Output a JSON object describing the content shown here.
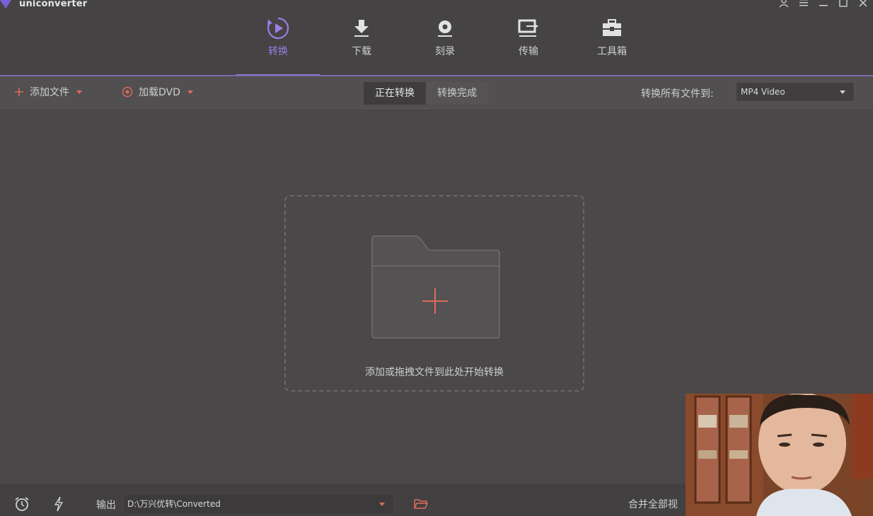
{
  "app": {
    "title": "uniconverter"
  },
  "nav": {
    "items": [
      {
        "label": "转换",
        "icon": "convert-icon",
        "active": true
      },
      {
        "label": "下载",
        "icon": "download-icon",
        "active": false
      },
      {
        "label": "刻录",
        "icon": "burn-disc-icon",
        "active": false
      },
      {
        "label": "传输",
        "icon": "transfer-icon",
        "active": false
      },
      {
        "label": "工具箱",
        "icon": "toolbox-icon",
        "active": false
      }
    ]
  },
  "toolbar": {
    "add_files_label": "添加文件",
    "load_dvd_label": "加载DVD",
    "tabs": [
      {
        "label": "正在转换",
        "active": true
      },
      {
        "label": "转换完成",
        "active": false
      }
    ],
    "convert_all_label": "转换所有文件到:",
    "format_value": "MP4 Video"
  },
  "dropzone": {
    "hint": "添加或拖拽文件到此处开始转换"
  },
  "bottom": {
    "output_label": "输出",
    "output_path": "D:\\万兴优转\\Converted",
    "merge_label": "合并全部视"
  },
  "colors": {
    "accent": "#9b7fe6",
    "orange": "#e06a5e",
    "bg": "#4a4848"
  }
}
